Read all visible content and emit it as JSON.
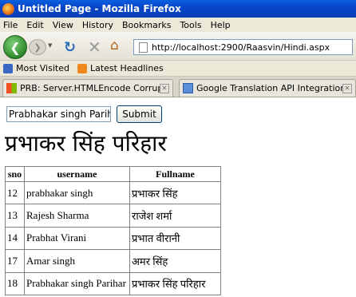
{
  "window": {
    "title": "Untitled Page - Mozilla Firefox"
  },
  "menu": [
    "File",
    "Edit",
    "View",
    "History",
    "Bookmarks",
    "Tools",
    "Help"
  ],
  "nav": {
    "url": "http://localhost:2900/Raasvin/Hindi.aspx"
  },
  "bookmarks": [
    "Most Visited",
    "Latest Headlines"
  ],
  "tabs": [
    {
      "label": "PRB: Server.HTMLEncode Corrupts U..."
    },
    {
      "label": "Google Translation API Integration in ..."
    }
  ],
  "form": {
    "name_value": "Prabhakar singh Parihar",
    "submit_label": "Submit"
  },
  "heading": "प्रभाकर सिंह परिहार",
  "table": {
    "headers": [
      "sno",
      "username",
      "Fullname"
    ],
    "rows": [
      [
        "12",
        "prabhakar singh",
        "प्रभाकर सिंह"
      ],
      [
        "13",
        "Rajesh Sharma",
        "राजेश शर्मा"
      ],
      [
        "14",
        "Prabhat Virani",
        "प्रभात वीरानी"
      ],
      [
        "17",
        "Amar singh",
        "अमर सिंह"
      ],
      [
        "18",
        "Prabhakar singh Parihar",
        "प्रभाकर सिंह परिहार"
      ]
    ]
  }
}
